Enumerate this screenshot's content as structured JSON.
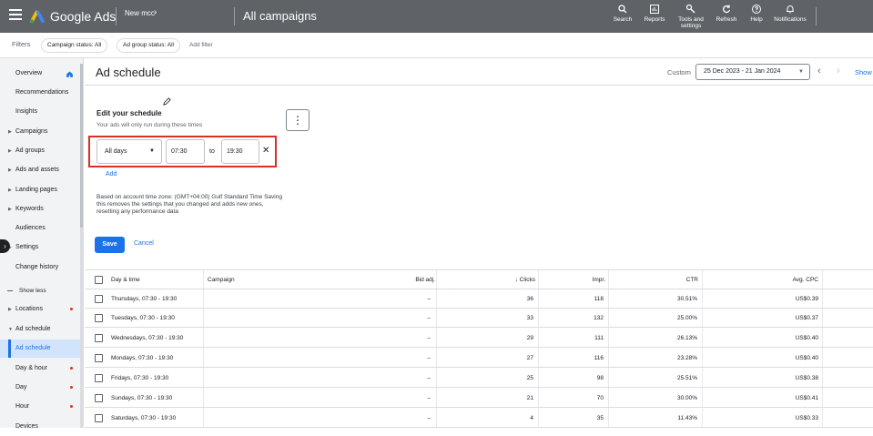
{
  "topbar": {
    "brand": "Google Ads",
    "account": "New mcc",
    "section_title": "All campaigns",
    "tools": [
      {
        "icon": "search-icon",
        "label": "Search"
      },
      {
        "icon": "reports-icon",
        "label": "Reports"
      },
      {
        "icon": "wrench-icon",
        "label": "Tools and settings"
      },
      {
        "icon": "refresh-icon",
        "label": "Refresh"
      },
      {
        "icon": "help-icon",
        "label": "Help"
      },
      {
        "icon": "bell-icon",
        "label": "Notifications"
      }
    ]
  },
  "filterbar": {
    "label": "Filters",
    "chips": [
      "Campaign status: All",
      "Ad group status: All"
    ],
    "add_filter": "Add filter"
  },
  "sidebar": {
    "items": [
      {
        "label": "Overview",
        "expandable": false,
        "dot": false,
        "icon": "home-icon"
      },
      {
        "label": "Recommendations",
        "expandable": false,
        "dot": false
      },
      {
        "label": "Insights",
        "expandable": false,
        "dot": false
      },
      {
        "label": "Campaigns",
        "expandable": true,
        "dot": false
      },
      {
        "label": "Ad groups",
        "expandable": true,
        "dot": false
      },
      {
        "label": "Ads and assets",
        "expandable": true,
        "dot": false
      },
      {
        "label": "Landing pages",
        "expandable": true,
        "dot": false
      },
      {
        "label": "Keywords",
        "expandable": true,
        "dot": false
      },
      {
        "label": "Audiences",
        "expandable": false,
        "dot": false
      },
      {
        "label": "Settings",
        "expandable": true,
        "dot": false
      },
      {
        "label": "Change history",
        "expandable": false,
        "dot": false
      },
      {
        "label": "Show less",
        "expandable": false,
        "dot": false
      },
      {
        "label": "Locations",
        "expandable": true,
        "dot": true
      },
      {
        "label": "Ad schedule",
        "expandable": true,
        "dot": false
      },
      {
        "label": "Ad schedule",
        "expandable": false,
        "dot": false,
        "selected": true
      },
      {
        "label": "Day & hour",
        "expandable": false,
        "dot": true
      },
      {
        "label": "Day",
        "expandable": false,
        "dot": true
      },
      {
        "label": "Hour",
        "expandable": false,
        "dot": true
      },
      {
        "label": "Devices",
        "expandable": false,
        "dot": false
      }
    ]
  },
  "header": {
    "title": "Ad schedule",
    "date_mode": "Custom",
    "date_range": "25 Dec 2023 - 21 Jan 2024",
    "show_label": "Show"
  },
  "schedule": {
    "title": "Edit your schedule",
    "subtitle": "Your ads will only run during these times",
    "days_value": "All days",
    "start_time": "07:30",
    "to_label": "to",
    "end_time": "19:30",
    "add_label": "Add",
    "timezone_note": "Based on account time zone: (GMT+04:00) Gulf Standard Time Saving this removes the settings that you changed and adds new ones, resetting any performance data",
    "save_label": "Save",
    "cancel_label": "Cancel"
  },
  "table": {
    "headers": {
      "day_time": "Day & time",
      "campaign": "Campaign",
      "bid_adj": "Bid adj.",
      "clicks": "↓ Clicks",
      "impr": "Impr.",
      "ctr": "CTR",
      "avg_cpc": "Avg. CPC"
    },
    "rows": [
      {
        "day_time": "Thursdays, 07:30 - 19:30",
        "campaign": "",
        "bid_adj": "–",
        "clicks": "36",
        "impr": "118",
        "ctr": "30.51%",
        "avg_cpc": "US$0.39"
      },
      {
        "day_time": "Tuesdays, 07:30 - 19:30",
        "campaign": "",
        "bid_adj": "–",
        "clicks": "33",
        "impr": "132",
        "ctr": "25.00%",
        "avg_cpc": "US$0.37"
      },
      {
        "day_time": "Wednesdays, 07:30 - 19:30",
        "campaign": "",
        "bid_adj": "–",
        "clicks": "29",
        "impr": "111",
        "ctr": "26.13%",
        "avg_cpc": "US$0.40"
      },
      {
        "day_time": "Mondays, 07:30 - 19:30",
        "campaign": "",
        "bid_adj": "–",
        "clicks": "27",
        "impr": "116",
        "ctr": "23.28%",
        "avg_cpc": "US$0.40"
      },
      {
        "day_time": "Fridays, 07:30 - 19:30",
        "campaign": "",
        "bid_adj": "–",
        "clicks": "25",
        "impr": "98",
        "ctr": "25.51%",
        "avg_cpc": "US$0.38"
      },
      {
        "day_time": "Sundays, 07:30 - 19:30",
        "campaign": "",
        "bid_adj": "–",
        "clicks": "21",
        "impr": "70",
        "ctr": "30.00%",
        "avg_cpc": "US$0.41"
      },
      {
        "day_time": "Saturdays, 07:30 - 19:30",
        "campaign": "",
        "bid_adj": "–",
        "clicks": "4",
        "impr": "35",
        "ctr": "11.43%",
        "avg_cpc": "US$0.33"
      }
    ]
  },
  "colors": {
    "topbar": "#5f6368",
    "accent": "#1a73e8",
    "highlight": "#d93025"
  }
}
